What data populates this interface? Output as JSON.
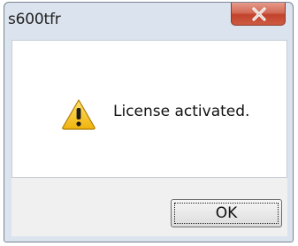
{
  "window": {
    "title": "s600tfr",
    "close_icon": "close-icon"
  },
  "dialog": {
    "icon": "warning-icon",
    "message": "License activated.",
    "ok_label": "OK"
  },
  "colors": {
    "titlebar": "#dbe4ee",
    "close_button": "#c2432c",
    "warning_yellow": "#f4c21a"
  }
}
